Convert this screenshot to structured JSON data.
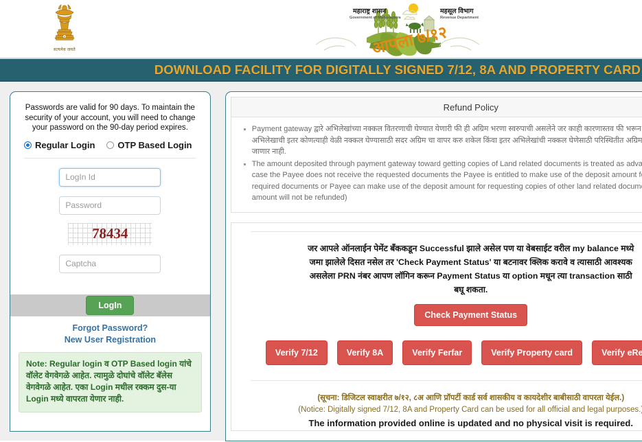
{
  "header": {
    "emblem_caption": "सत्यमेव जयते",
    "logo": {
      "left_devanagari": "महाराष्ट्र शासन",
      "left_english": "Government of Maharashtra",
      "right_devanagari": "महसूल विभाग",
      "right_english": "Revenue Department",
      "wordmark": "आपला ७/१२"
    }
  },
  "title_band": {
    "text": "DOWNLOAD FACILITY FOR DIGITALLY SIGNED 7/12, 8A AND PROPERTY CARD",
    "bg_color": "#27616f",
    "text_color": "#e8a72a"
  },
  "login": {
    "password_notice": "Passwords are valid for 90 days. To maintain the security of your account, you will need to change your password on the 90-day period expires.",
    "modes": [
      {
        "label": "Regular Login",
        "selected": true
      },
      {
        "label": "OTP Based Login",
        "selected": false
      }
    ],
    "login_id_placeholder": "LogIn Id",
    "login_id_value": "",
    "password_placeholder": "Password",
    "password_value": "",
    "captcha_text": "78434",
    "captcha_placeholder": "Captcha",
    "captcha_value": "",
    "login_button": "LogIn",
    "forgot_password_link": "Forgot Password?",
    "new_user_link": "New User Registration",
    "note": "Note: Regular login व OTP Based login यांचे वॉलेट वेगवेगळे आहेत. त्यामुळे दोघांचे वॉलेट बॅलेस वेगवेगळे आहेत. एका Login मधील रक्कम दुस-या Login मध्ये वापरता येणार नाही."
  },
  "refund_policy": {
    "title": "Refund Policy",
    "items": [
      "Payment gateway द्वारे अभिलेखांच्या नक्कल वितरणाची घेण्यात येणारी फी ही अग्रिम भरणा स्वरुपाची असलेने जर काही कारणास्तव फी भरून किंवा संस्था त्याच अभिलेखाची इतर कोणत्याही वेळी नक्कल घेण्यासाठी सदर अग्रिम चा वापर करु शकेल किंवा इतर अभिलेखांची नक्कल घेणेसाठी परिस्थितीत अग्रिम रक्कम परत केली जाणार नाही.",
      "The amount deposited through payment gateway toward getting copies of Land related documents is treated as advance amount. In case the Payee does not receive the requested documents the Payee is entitled to make use of the deposit amount for getting required documents or Payee can make use of the deposit amount for requesting copies of other land related documents. (In any case amount will not be refunded)"
    ]
  },
  "payment": {
    "message": "जर आपले ऑनलाईन पेमेंट बँककडून Successful झाले असेल पण या वेबसाईट वरील my balance मध्ये जमा झालेले दिसत नसेल तर 'Check Payment Status' या बटनावर क्लिक करावे व त्यासाठी आवश्यक असलेला PRN नंबर आपण लॉगिन करून Payment Status या option मधून त्या transaction साठी बघू शकता.",
    "check_status_button": "Check Payment Status",
    "button_color": "#d9534f"
  },
  "verify_buttons": [
    "Verify 7/12",
    "Verify 8A",
    "Verify Ferfar",
    "Verify Property card",
    "Verify eRecords"
  ],
  "notice": {
    "marathi": "(सूचना: डिजिटल स्वाक्षरीत ७/१२, ८अ आणि प्रॉपर्टी कार्ड सर्व शासकीय व कायदेशीर बाबीसाठी वापरता येईल.)",
    "english": "(Notice: Digitally signed 7/12, 8A and Property Card can be used for all official and legal purposes.)",
    "highlight": "The information provided online is updated and no physical visit is required."
  }
}
